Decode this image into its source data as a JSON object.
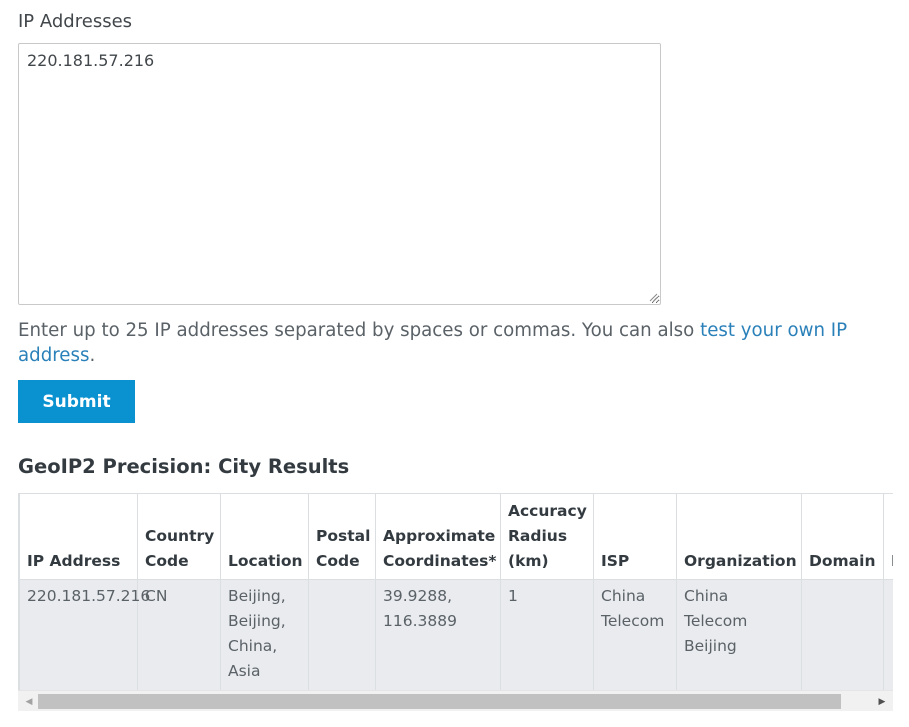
{
  "form": {
    "label": "IP Addresses",
    "textarea_value": "220.181.57.216",
    "help_text_prefix": "Enter up to 25 IP addresses separated by spaces or commas. You can also ",
    "help_link": "test your own IP address",
    "help_text_suffix": ".",
    "submit_label": "Submit"
  },
  "results": {
    "heading": "GeoIP2 Precision: City Results",
    "columns": [
      "IP Address",
      "Country Code",
      "Location",
      "Postal Code",
      "Approximate Coordinates*",
      "Accuracy Radius (km)",
      "ISP",
      "Organization",
      "Domain",
      "Metro Code"
    ],
    "rows": [
      {
        "ip_address": "220.181.57.216",
        "country_code": "CN",
        "location": "Beijing, Beijing, China, Asia",
        "postal_code": "",
        "coordinates": "39.9288, 116.3889",
        "accuracy_radius": "1",
        "isp": "China Telecom",
        "organization": "China Telecom Beijing",
        "domain": "",
        "metro_code": ""
      }
    ]
  },
  "colors": {
    "accent": "#0a91d0",
    "link": "#2a80b9",
    "row_background": "#e9ebee"
  },
  "icons": {
    "scroll_left": "triangle-left-icon",
    "scroll_right": "triangle-right-icon",
    "resize": "resize-grip-icon"
  }
}
